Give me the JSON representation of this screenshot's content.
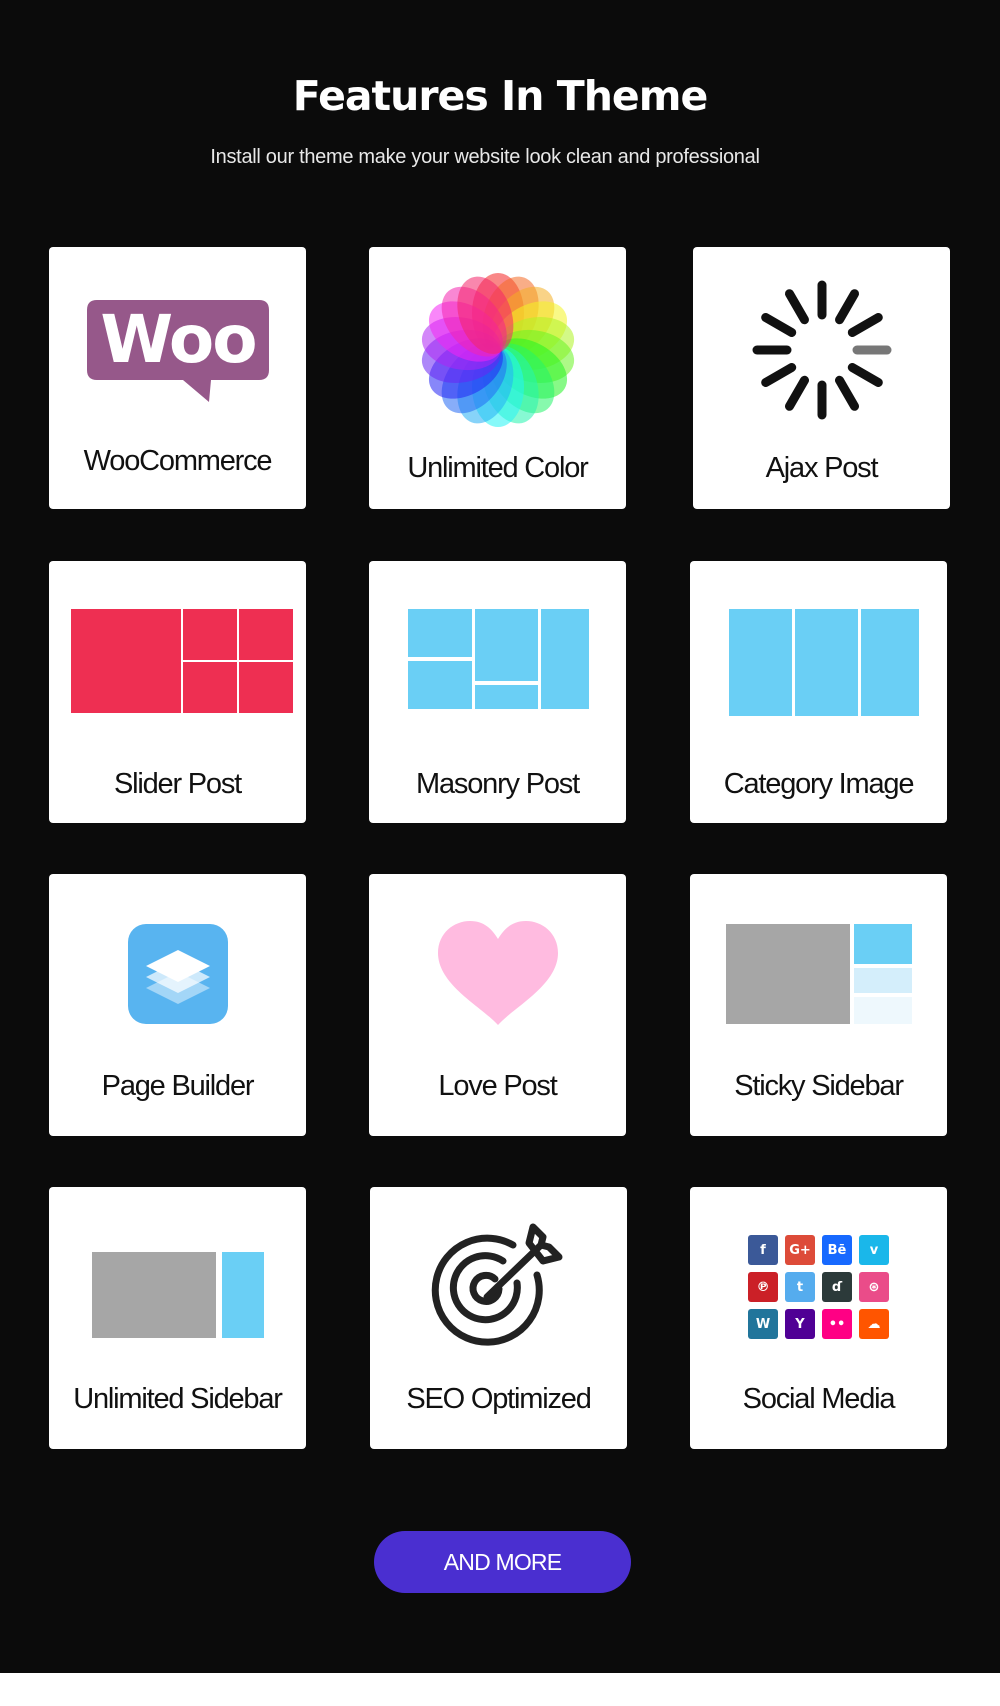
{
  "header": {
    "title": "Features In Theme",
    "subtitle": "Install our theme make your website look clean and professional"
  },
  "features": [
    {
      "label": "WooCommerce",
      "icon": "woocommerce-logo-icon",
      "logo_text": "Woo"
    },
    {
      "label": "Unlimited Color",
      "icon": "color-wheel-icon"
    },
    {
      "label": "Ajax Post",
      "icon": "loading-spinner-icon"
    },
    {
      "label": "Slider Post",
      "icon": "slider-layout-icon"
    },
    {
      "label": "Masonry Post",
      "icon": "masonry-layout-icon"
    },
    {
      "label": "Category Image",
      "icon": "category-columns-icon"
    },
    {
      "label": "Page Builder",
      "icon": "layers-icon"
    },
    {
      "label": "Love Post",
      "icon": "heart-icon"
    },
    {
      "label": "Sticky Sidebar",
      "icon": "sticky-sidebar-layout-icon"
    },
    {
      "label": "Unlimited Sidebar",
      "icon": "sidebar-layout-icon"
    },
    {
      "label": "SEO Optimized",
      "icon": "target-arrow-icon"
    },
    {
      "label": "Social Media",
      "icon": "social-icons-grid-icon"
    }
  ],
  "social_icons": [
    {
      "name": "facebook",
      "glyph": "f",
      "color": "#3b5998"
    },
    {
      "name": "google-plus",
      "glyph": "G+",
      "color": "#dd4b39"
    },
    {
      "name": "behance",
      "glyph": "Bē",
      "color": "#1769ff"
    },
    {
      "name": "vimeo",
      "glyph": "v",
      "color": "#1ab7ea"
    },
    {
      "name": "pinterest",
      "glyph": "℗",
      "color": "#cb2027"
    },
    {
      "name": "twitter",
      "glyph": "t",
      "color": "#55acee"
    },
    {
      "name": "deviantart",
      "glyph": "ɗ",
      "color": "#2c3a3a"
    },
    {
      "name": "dribbble",
      "glyph": "⊛",
      "color": "#ea4c89"
    },
    {
      "name": "wordpress",
      "glyph": "W",
      "color": "#21759b"
    },
    {
      "name": "yahoo",
      "glyph": "Y",
      "color": "#500095"
    },
    {
      "name": "flickr",
      "glyph": "••",
      "color": "#ff0084"
    },
    {
      "name": "soundcloud",
      "glyph": "☁",
      "color": "#ff5500"
    }
  ],
  "cta": {
    "label": "AND MORE"
  },
  "colors": {
    "background": "#0b0b0b",
    "card": "#ffffff",
    "accent_button": "#4a2fd0",
    "woo_purple": "#96588a",
    "slider_red": "#ee2f52",
    "layout_blue": "#6acff5",
    "layout_gray": "#a6a6a6",
    "heart_pink": "#ffbbe0",
    "page_builder_blue": "#58b4f0"
  }
}
